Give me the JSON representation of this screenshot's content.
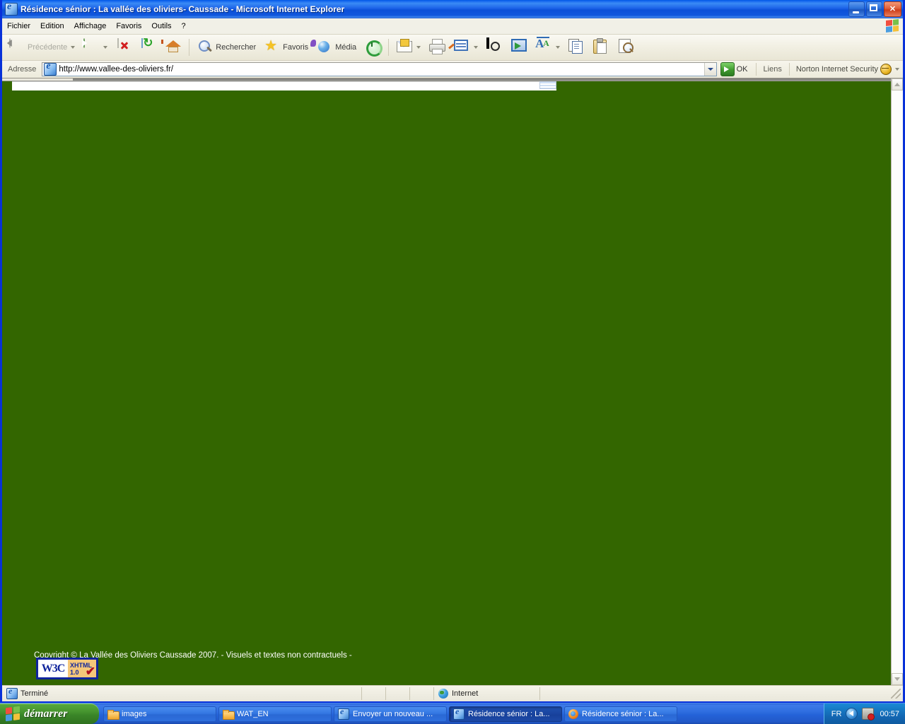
{
  "window": {
    "title": "Résidence sénior : La vallée des oliviers- Caussade - Microsoft Internet Explorer",
    "title_icon": "ie-document-icon",
    "minimize_label": "Réduire",
    "maximize_label": "Agrandir",
    "close_label": "Fermer"
  },
  "menu": {
    "items": [
      {
        "label": "Fichier"
      },
      {
        "label": "Edition"
      },
      {
        "label": "Affichage"
      },
      {
        "label": "Favoris"
      },
      {
        "label": "Outils"
      },
      {
        "label": "?"
      }
    ],
    "logo": "windows-flag-icon"
  },
  "toolbar": {
    "back_label": "Précédente",
    "forward_label": "",
    "search_label": "Rechercher",
    "favorites_label": "Favoris",
    "media_label": "Média",
    "icons": {
      "back": "back-arrow-icon",
      "forward": "forward-arrow-icon",
      "stop": "stop-icon",
      "refresh": "refresh-icon",
      "home": "home-icon",
      "search": "magnifier-icon",
      "favorites": "star-icon",
      "media": "media-ball-icon",
      "history": "history-swirl-icon",
      "mail": "mail-icon",
      "print": "printer-icon",
      "edit": "edit-document-icon",
      "discuss": "discuss-icon",
      "messenger": "messenger-icon",
      "fontsize": "font-size-icon",
      "copy": "copy-icon",
      "paste": "paste-icon",
      "find": "find-icon"
    }
  },
  "address": {
    "label": "Adresse",
    "url": "http://www.vallee-des-oliviers.fr/",
    "placeholder": "http://",
    "favicon": "ie-page-icon",
    "dropdown_icon": "chevron-down-icon",
    "go_label": "OK",
    "go_icon": "go-arrow-icon",
    "links_label": "Liens",
    "norton_label": "Norton Internet Security",
    "norton_icon": "norton-globe-icon"
  },
  "page": {
    "background_color": "#336600",
    "copyright": "Copyright © La Vallée des Oliviers Caussade 2007. - Visuels et textes non contractuels -",
    "w3c_badge": {
      "left_text": "W3C",
      "line1": "XHTML",
      "line2": "1.0",
      "check_icon": "red-check-icon",
      "border_color": "#10259c",
      "right_bg_color": "#f5c77a"
    }
  },
  "scrollbar": {
    "up_icon": "scroll-up-icon",
    "down_icon": "scroll-down-icon"
  },
  "statusbar": {
    "status_text": "Terminé",
    "status_icon": "ie-page-icon",
    "zone_text": "Internet",
    "zone_icon": "internet-globe-icon",
    "resize_grip": "resize-grip-icon"
  },
  "taskbar": {
    "start_label": "démarrer",
    "start_icon": "windows-flag-icon",
    "tasks": [
      {
        "label": "images",
        "icon": "folder-icon",
        "active": false
      },
      {
        "label": "WAT_EN",
        "icon": "folder-icon",
        "active": false
      },
      {
        "label": "Envoyer un nouveau ...",
        "icon": "ie-page-icon",
        "active": false
      },
      {
        "label": "Résidence sénior : La...",
        "icon": "ie-page-icon",
        "active": true
      },
      {
        "label": "Résidence sénior : La...",
        "icon": "firefox-icon",
        "active": false
      }
    ],
    "tray": {
      "language": "FR",
      "icons": [
        "shield-icon",
        "network-error-icon"
      ],
      "clock": "00:57"
    }
  }
}
